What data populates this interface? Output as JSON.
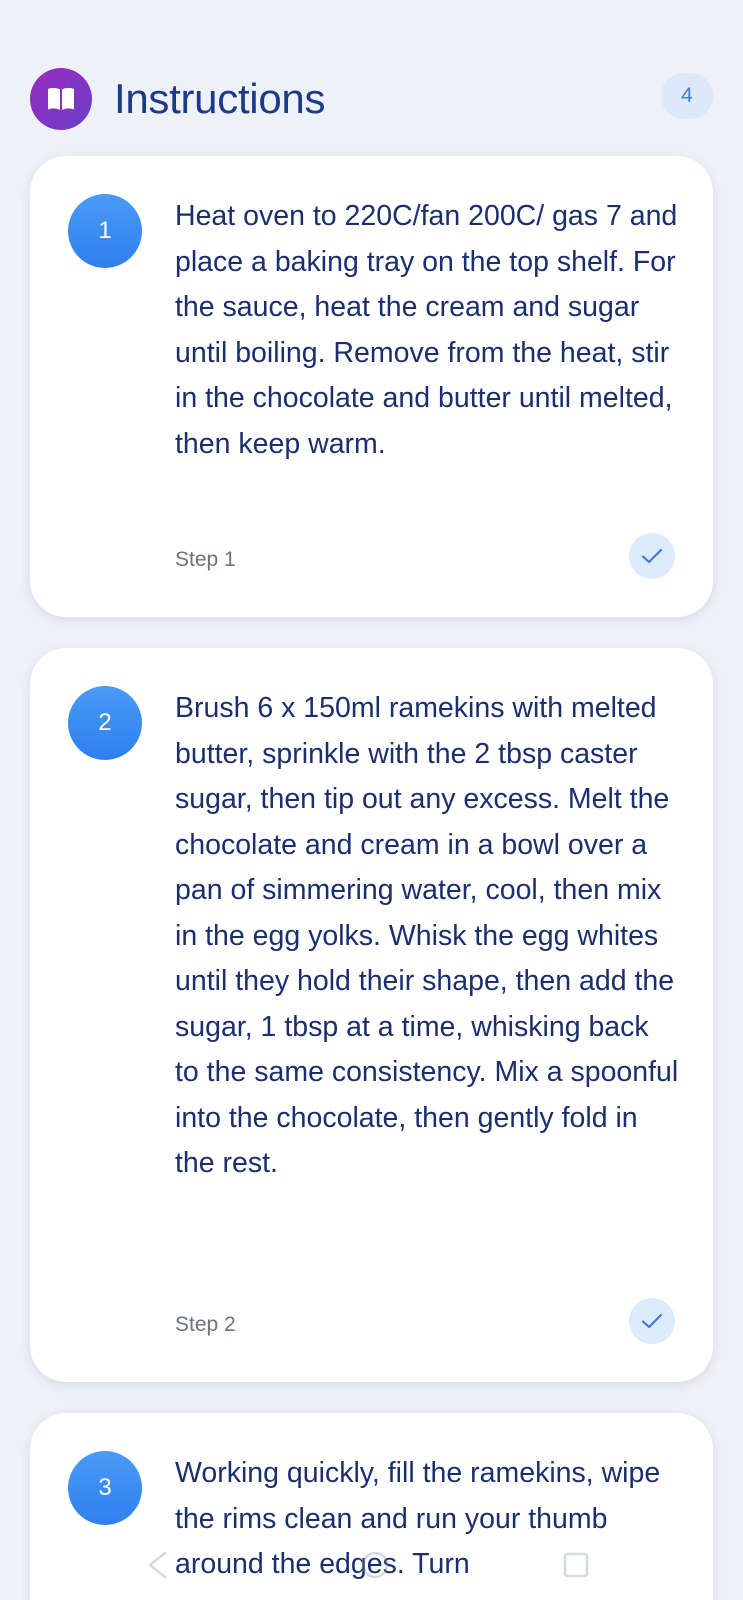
{
  "header": {
    "title": "Instructions",
    "count": "4",
    "icon": "open-book-icon",
    "accent_gradient": [
      "#9a2bbd",
      "#6a3fc9"
    ]
  },
  "steps": [
    {
      "number": "1",
      "text": "Heat oven to 220C/fan 200C/ gas 7 and place a baking tray on the top shelf. For the sauce, heat the cream and sugar until boiling. Remove from the heat, stir in the chocolate and butter until melted, then keep warm.",
      "label": "Step 1"
    },
    {
      "number": "2",
      "text": "Brush 6 x 150ml ramekins with melted butter, sprinkle with the 2 tbsp caster sugar, then tip out any excess. Melt the chocolate and cream in a bowl over a pan of simmering water, cool, then mix in the egg yolks. Whisk the egg whites until they hold their shape, then add the sugar, 1 tbsp at a time, whisking back to the same consistency. Mix a spoonful into the chocolate, then gently fold in the rest.",
      "label": "Step 2"
    },
    {
      "number": "3",
      "text": "Working quickly, fill the ramekins, wipe the rims clean and run your thumb around the edges. Turn"
    }
  ],
  "colors": {
    "background": "#eef1f7",
    "step_badge": "#2f7ff0",
    "text": "#1b2f6e",
    "check": "#3d7be0"
  }
}
